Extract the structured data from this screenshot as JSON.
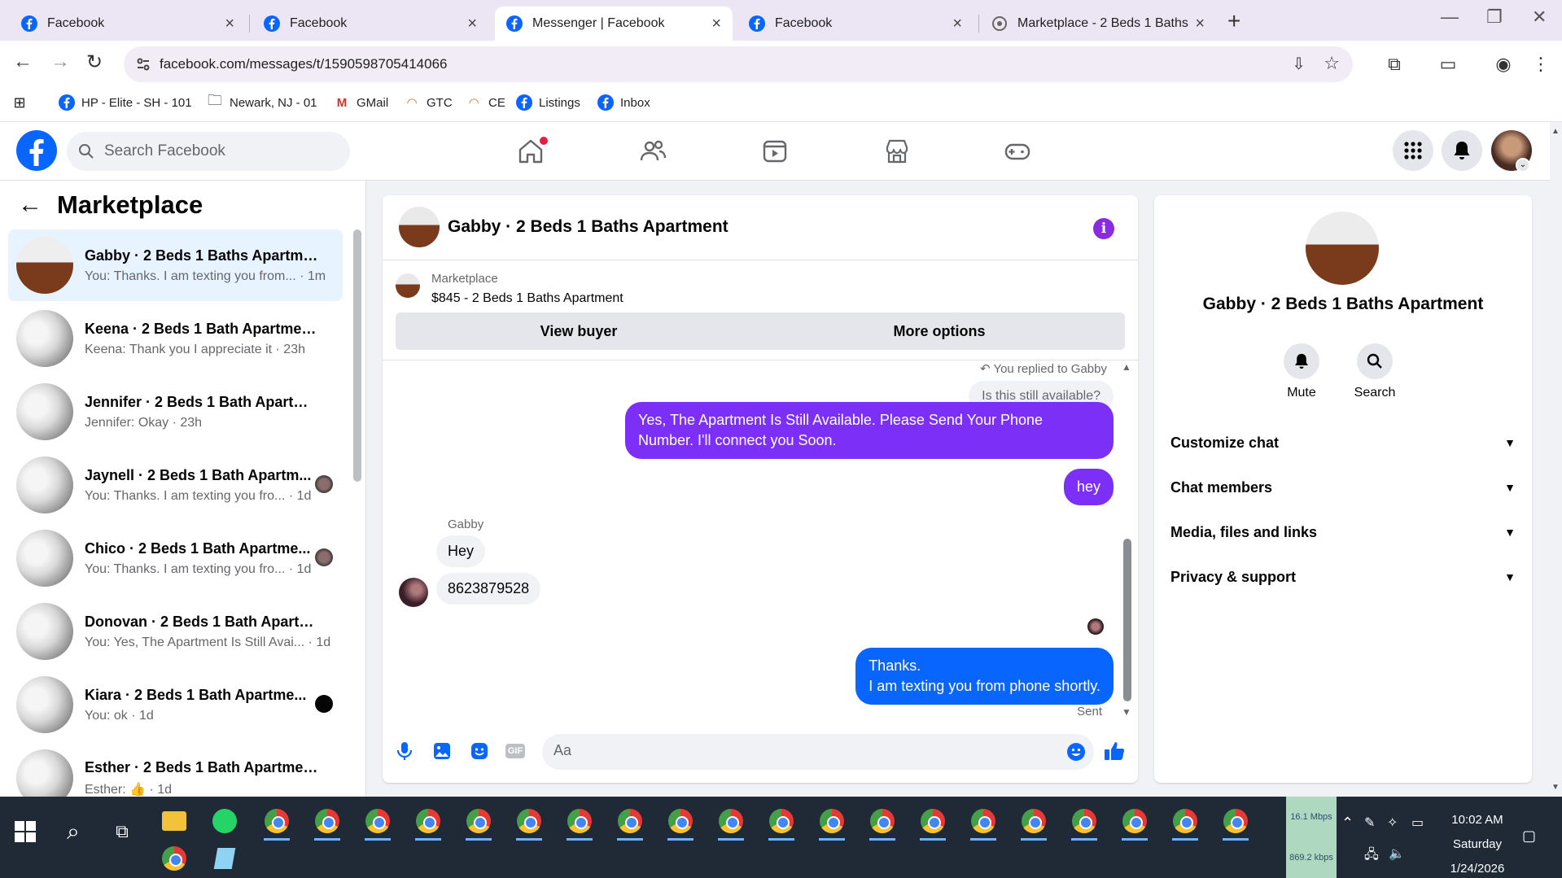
{
  "browser": {
    "tabs": [
      {
        "title": "Facebook",
        "active": false
      },
      {
        "title": "Facebook",
        "active": false
      },
      {
        "title": "Messenger | Facebook",
        "active": true
      },
      {
        "title": "Facebook",
        "active": false
      },
      {
        "title": "Marketplace - 2 Beds 1 Baths Apartment",
        "active": false
      }
    ],
    "url": "facebook.com/messages/t/1590598705414066",
    "bookmarks": [
      "HP - Elite - SH - 101",
      "Newark, NJ - 01",
      "GMail",
      "GTC",
      "CE",
      "Listings",
      "Inbox"
    ]
  },
  "fb": {
    "search_placeholder": "Search Facebook",
    "accent": "#0866ff",
    "purple_accent": "#7b2ff7"
  },
  "sidebar": {
    "title": "Marketplace",
    "conversations": [
      {
        "name": "Gabby · 2 Beds 1 Baths Apartment",
        "preview": "You: Thanks. I am texting you from... · 1m",
        "active": true
      },
      {
        "name": "Keena · 2 Beds 1 Bath Apartmen...",
        "preview": "Keena: Thank you I appreciate it · 23h"
      },
      {
        "name": "Jennifer · 2 Beds 1 Bath Apartme...",
        "preview": "Jennifer: Okay · 23h"
      },
      {
        "name": "Jaynell · 2 Beds 1 Bath Apartm...",
        "preview": "You: Thanks. I am texting you fro... · 1d"
      },
      {
        "name": "Chico · 2 Beds 1 Bath Apartme...",
        "preview": "You: Thanks. I am texting you fro... · 1d"
      },
      {
        "name": "Donovan · 2 Beds 1 Bath Apartm...",
        "preview": "You: Yes, The Apartment Is Still Avai... · 1d"
      },
      {
        "name": "Kiara · 2 Beds 1 Bath Apartme...",
        "preview": "You: ok · 1d"
      },
      {
        "name": "Esther · 2 Beds 1 Bath Apartmen...",
        "preview": "Esther: 👍 · 1d"
      }
    ]
  },
  "chat": {
    "title": "Gabby · 2 Beds 1 Baths Apartment",
    "marketplace_label": "Marketplace",
    "listing": "$845 - 2 Beds 1 Baths Apartment",
    "view_buyer": "View buyer",
    "more_options": "More options",
    "reply_note": "You replied to Gabby",
    "quoted": "Is this still available?",
    "msg_out_1": "Yes, The Apartment Is Still Available. Please Send Your Phone Number. I'll connect you Soon.",
    "msg_out_2": "hey",
    "sender": "Gabby",
    "msg_in_1": "Hey",
    "msg_in_2": "8623879528",
    "msg_out_3_line1": "Thanks.",
    "msg_out_3_line2": "I am texting you from phone shortly.",
    "status": "Sent",
    "composer_placeholder": "Aa",
    "gif_label": "GIF"
  },
  "info": {
    "name": "Gabby · 2 Beds 1 Baths Apartment",
    "mute": "Mute",
    "search": "Search",
    "sections": [
      "Customize chat",
      "Chat members",
      "Media, files and links",
      "Privacy & support"
    ]
  },
  "taskbar": {
    "upload": "16.1 Mbps",
    "download": "869.2 kbps",
    "time": "10:02 AM",
    "day": "Saturday",
    "date": "1/24/2026"
  }
}
